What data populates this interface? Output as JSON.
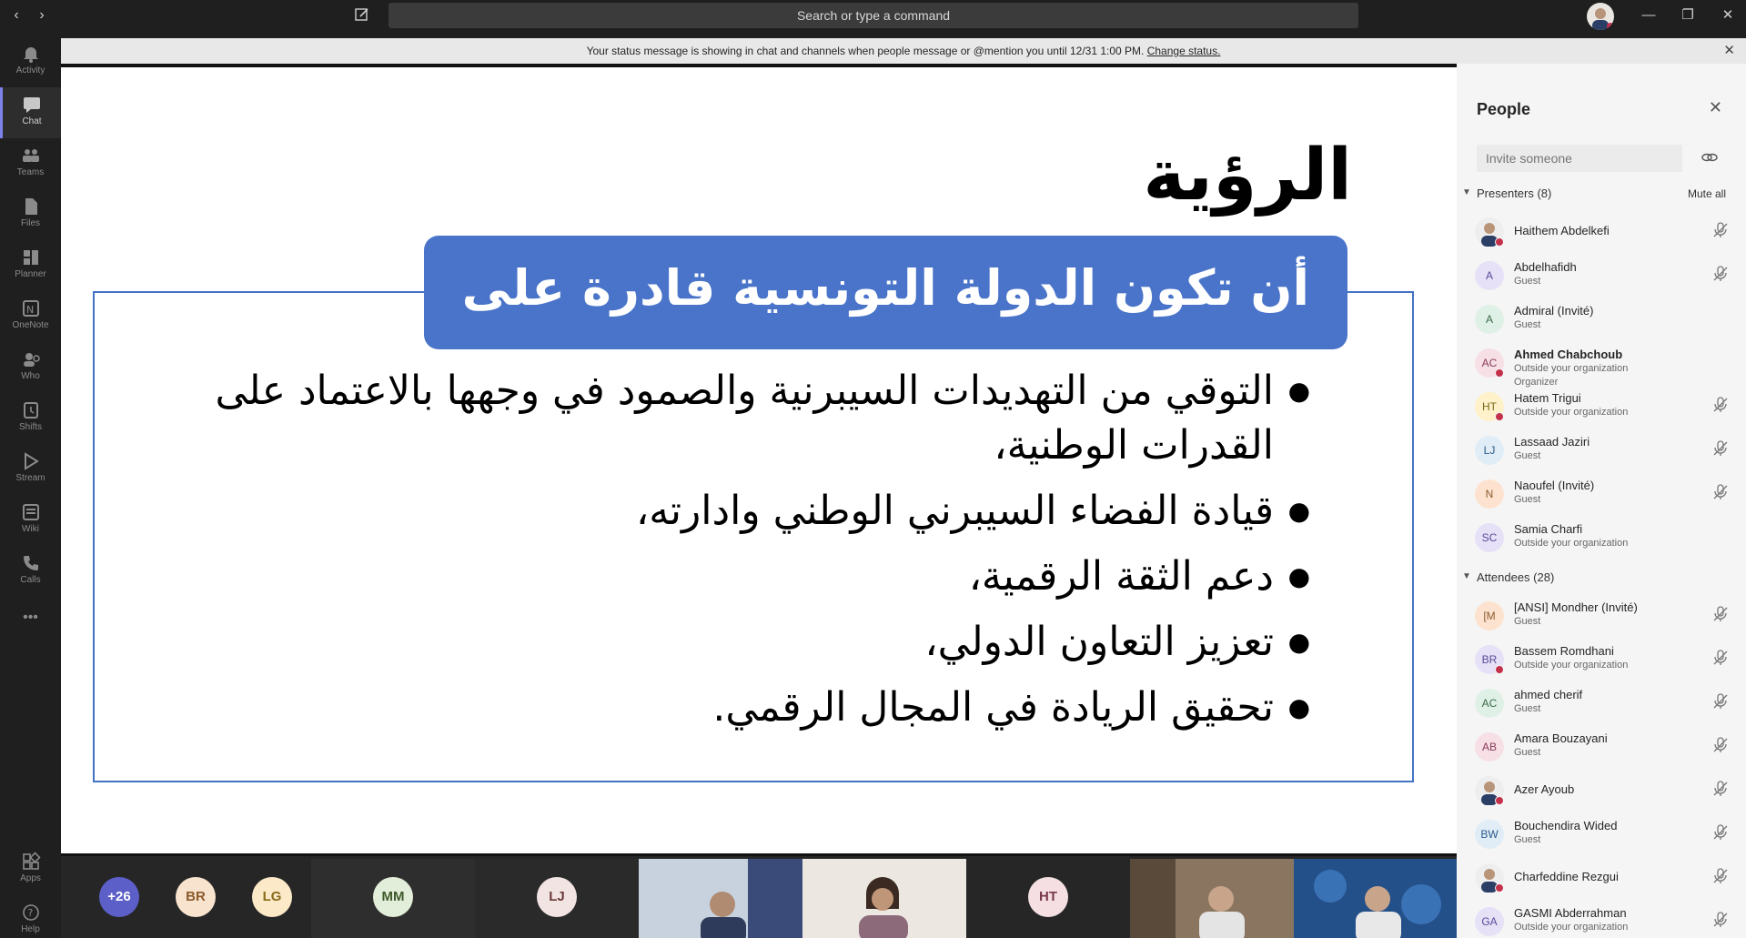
{
  "titlebar": {
    "search_placeholder": "Search or type a command"
  },
  "rail": {
    "items": [
      {
        "label": "Activity",
        "icon": "bell-icon"
      },
      {
        "label": "Chat",
        "icon": "chat-icon"
      },
      {
        "label": "Teams",
        "icon": "teams-icon"
      },
      {
        "label": "Files",
        "icon": "files-icon"
      },
      {
        "label": "Planner",
        "icon": "planner-icon"
      },
      {
        "label": "OneNote",
        "icon": "onenote-icon"
      },
      {
        "label": "Who",
        "icon": "who-icon"
      },
      {
        "label": "Shifts",
        "icon": "shifts-icon"
      },
      {
        "label": "Stream",
        "icon": "stream-icon"
      },
      {
        "label": "Wiki",
        "icon": "wiki-icon"
      },
      {
        "label": "Calls",
        "icon": "calls-icon"
      },
      {
        "label": "Apps",
        "icon": "apps-icon"
      },
      {
        "label": "Help",
        "icon": "help-icon"
      }
    ],
    "more": "•••"
  },
  "notice": {
    "text": "Your status message is showing in chat and channels when people message or @mention you until 12/31 1:00 PM.",
    "link": "Change status."
  },
  "slide": {
    "title": "الرؤية",
    "banner": "أن تكون الدولة التونسية قادرة على",
    "bullets": [
      "التوقي من التهديدات السيبرنية والصمود في وجهها بالاعتماد على القدرات الوطنية،",
      "قيادة الفضاء السيبرني الوطني وادارته،",
      "دعم الثقة الرقمية،",
      "تعزيز التعاون الدولي،",
      "تحقيق الريادة  في المجال الرقمي."
    ]
  },
  "strip": {
    "overflow": "+26",
    "initials": [
      "BR",
      "LG",
      "MM",
      "LJ",
      "HT"
    ]
  },
  "people": {
    "title": "People",
    "invite_placeholder": "Invite someone",
    "presenters_header": "Presenters (8)",
    "mute_all": "Mute all",
    "attendees_header": "Attendees (28)",
    "presenters": [
      {
        "name": "Haithem Abdelkefi",
        "role": "",
        "initials": "",
        "photo": true,
        "dot": true,
        "mic": true
      },
      {
        "name": "Abdelhafidh",
        "role": "Guest",
        "initials": "A",
        "photo": false,
        "dot": false,
        "mic": true
      },
      {
        "name": "Admiral (Invité)",
        "role": "Guest",
        "initials": "A",
        "photo": false,
        "dot": false,
        "mic": false
      },
      {
        "name": "Ahmed Chabchoub",
        "role": "Outside your organization",
        "role2": "Organizer",
        "initials": "AC",
        "photo": false,
        "dot": true,
        "mic": false,
        "bold": true
      },
      {
        "name": "Hatem Trigui",
        "role": "Outside your organization",
        "initials": "HT",
        "photo": false,
        "dot": true,
        "mic": true
      },
      {
        "name": "Lassaad Jaziri",
        "role": "Guest",
        "initials": "LJ",
        "photo": false,
        "dot": false,
        "mic": true
      },
      {
        "name": "Naoufel (Invité)",
        "role": "Guest",
        "initials": "N",
        "photo": false,
        "dot": false,
        "mic": true
      },
      {
        "name": "Samia Charfi",
        "role": "Outside your organization",
        "initials": "SC",
        "photo": false,
        "dot": false,
        "mic": false
      }
    ],
    "attendees": [
      {
        "name": "[ANSI] Mondher (Invité)",
        "role": "Guest",
        "initials": "[M",
        "photo": false,
        "dot": false,
        "mic": true
      },
      {
        "name": "Bassem Romdhani",
        "role": "Outside your organization",
        "initials": "BR",
        "photo": false,
        "dot": true,
        "mic": true
      },
      {
        "name": "ahmed cherif",
        "role": "Guest",
        "initials": "AC",
        "photo": false,
        "dot": false,
        "mic": true
      },
      {
        "name": "Amara Bouzayani",
        "role": "Guest",
        "initials": "AB",
        "photo": false,
        "dot": false,
        "mic": true
      },
      {
        "name": "Azer Ayoub",
        "role": "",
        "initials": "",
        "photo": true,
        "dot": true,
        "mic": true
      },
      {
        "name": "Bouchendira Wided",
        "role": "Guest",
        "initials": "BW",
        "photo": false,
        "dot": false,
        "mic": true
      },
      {
        "name": "Charfeddine Rezgui",
        "role": "",
        "initials": "",
        "photo": true,
        "dot": true,
        "mic": true
      },
      {
        "name": "GASMI Abderrahman",
        "role": "Outside your organization",
        "initials": "GA",
        "photo": false,
        "dot": false,
        "mic": true
      }
    ]
  },
  "colors": {
    "accent": "#7b83eb",
    "slide_blue": "#4a74c9",
    "busy": "#c4314b"
  }
}
